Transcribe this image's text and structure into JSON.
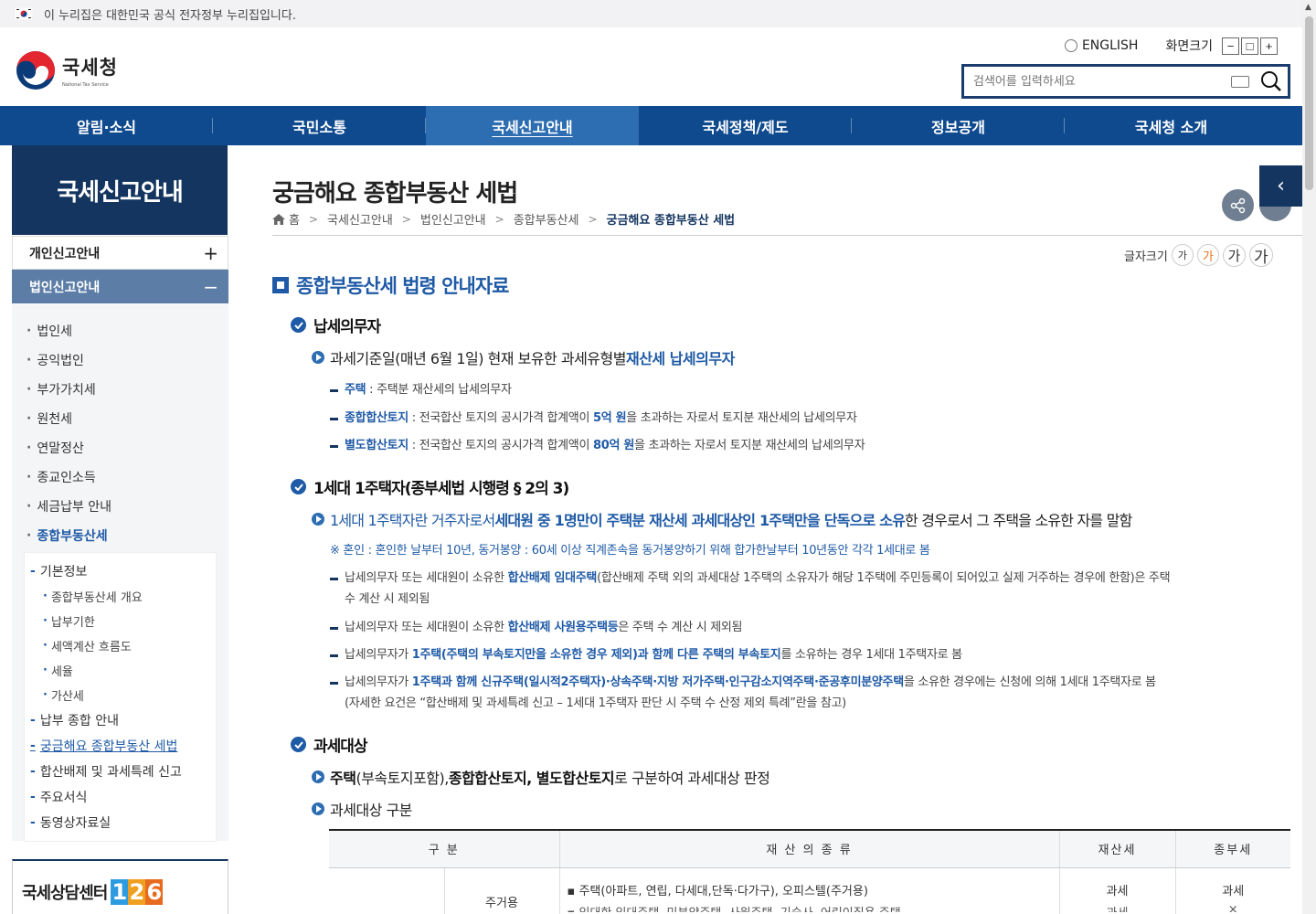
{
  "gov_banner": {
    "text": "이 누리집은 대한민국 공식 전자정부 누리집입니다."
  },
  "header": {
    "logo_ko": "국세청",
    "logo_en": "National Tax Service",
    "lang": "ENGLISH",
    "zoom_label": "화면크기",
    "zoom_minus": "−",
    "zoom_reset": "□",
    "zoom_plus": "+",
    "search_placeholder": "검색어를 입력하세요"
  },
  "gnb": [
    "알림·소식",
    "국민소통",
    "국세신고안내",
    "국세정책/제도",
    "정보공개",
    "국세청 소개"
  ],
  "lnb": {
    "title": "국세신고안내",
    "d1": [
      {
        "label": "개인신고안내",
        "icon": "+"
      },
      {
        "label": "법인신고안내",
        "icon": "−"
      }
    ],
    "d2": [
      "법인세",
      "공익법인",
      "부가가치세",
      "원천세",
      "연말정산",
      "종교인소득",
      "세금납부 안내",
      "종합부동산세"
    ],
    "d3": [
      "기본정보",
      "종합부동산세 개요",
      "납부기한",
      "세액계산 흐름도",
      "세율",
      "가산세",
      "납부 종합 안내",
      "궁금해요 종합부동산 세법",
      "합산배제 및 과세특례 신고",
      "주요서식",
      "동영상자료실"
    ],
    "callcenter": "국세상담센터",
    "callcenter_num": [
      "1",
      "2",
      "6"
    ]
  },
  "page": {
    "title": "궁금해요 종합부동산 세법",
    "breadcrumb": [
      "홈",
      "국세신고안내",
      "법인신고안내",
      "종합부동산세",
      "궁금해요 종합부동산 세법"
    ],
    "fontsize_label": "글자크기",
    "fontsize_btn": "가"
  },
  "content": {
    "section_title": "종합부동산세 법령 안내자료",
    "s1": {
      "title": "납세의무자",
      "p1_a": "과세기준일(매년 6월 1일) 현재 보유한 과세유형별 ",
      "p1_b": "재산세 납세의무자",
      "i1_a": "주택",
      "i1_b": " : 주택분 재산세의 납세의무자",
      "i2_a": "종합합산토지",
      "i2_b": " : 전국합산 토지의 공시가격 합계액이 ",
      "i2_c": "5억 원",
      "i2_d": "을 초과하는 자로서 토지분 재산세의 납세의무자",
      "i3_a": "별도합산토지",
      "i3_b": " : 전국합산 토지의 공시가격 합계액이 ",
      "i3_c": "80억 원",
      "i3_d": "을 초과하는 자로서 토지분 재산세의 납세의무자"
    },
    "s2": {
      "title": "1세대 1주택자(종부세법 시행령 § 2의 3)",
      "p1_a": "1세대 1주택자란 거주자로서 ",
      "p1_b": "세대원 중 1명만이 주택분 재산세 과세대상인 1주택만을 단독으로 소유",
      "p1_c": "한 경우로서 그 주택을 소유한 자를 말함",
      "note": "※ 혼인 : 혼인한 날부터 10년, 동거봉양 : 60세 이상 직계존속을 동거봉양하기 위해 합가한날부터 10년동안 각각 1세대로 봄",
      "i1_a": "납세의무자 또는 세대원이 소유한 ",
      "i1_b": "합산배제 임대주택",
      "i1_c": "(합산배제 주택 외의 과세대상 1주택의 소유자가 해당 1주택에 주민등록이 되어있고 실제 거주하는 경우에 한함)은 주택",
      "i1_d": "수 계산 시 제외됨",
      "i2_a": "납세의무자 또는 세대원이 소유한 ",
      "i2_b": "합산배제 사원용주택등",
      "i2_c": "은 주택 수 계산 시 제외됨",
      "i3_a": "납세의무자가 ",
      "i3_b": "1주택(주택의 부속토지만을 소유한 경우 제외)과 함께 다른 주택의 부속토지",
      "i3_c": "를 소유하는 경우 1세대 1주택자로 봄",
      "i4_a": "납세의무자가 ",
      "i4_b": "1주택과 함께 신규주택(일시적2주택자)·상속주택·지방 저가주택·인구감소지역주택·준공후미분양주택",
      "i4_c": "을 소유한 경우에는 신청에 의해 1세대 1주택자로 봄",
      "i4_d": "(자세한 요건은 “합산배제 및 과세특례 신고 – 1세대 1주택자 판단 시 주택 수 산정 제외 특례”란을 참고)"
    },
    "s3": {
      "title": "과세대상",
      "p1_a": "주택",
      "p1_b": "(부속토지포함), ",
      "p1_c": "종합합산토지, 별도합산토지",
      "p1_d": "로 구분하여 과세대상 판정",
      "p2": "과세대상 구분"
    },
    "table": {
      "headers": [
        "구 분",
        "재 산 의 종 류",
        "재산세",
        "종부세"
      ],
      "row1": {
        "sub": "주거용",
        "item1": "▪ 주택(아파트, 연립, 다세대,단독·다가구), 오피스텔(주거용)",
        "item2": "▪ 임대한 임대주택, 미분양주택, 사원주택, 기숙사, 어린이집용 주택",
        "tax1a": "과세",
        "tax1b": "과세",
        "tax2a": "과세",
        "tax2b": "×"
      }
    }
  }
}
